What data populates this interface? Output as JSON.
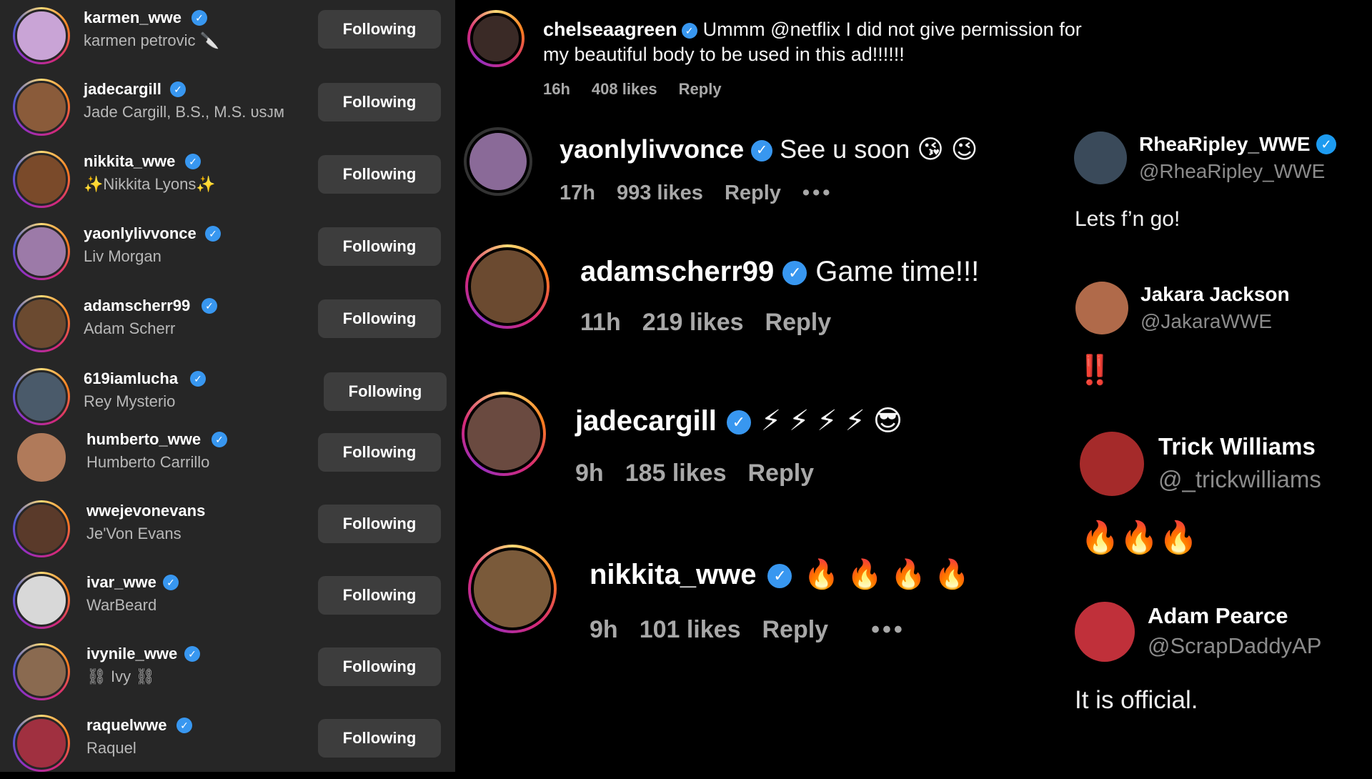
{
  "following": {
    "button_label": "Following",
    "items": [
      {
        "username": "karmen_wwe",
        "name": "karmen petrovic 🔪",
        "avatar_color": "#c9a4d6"
      },
      {
        "username": "jadecargill",
        "name": "Jade Cargill, B.S., M.S. ᴜsᴊᴍ",
        "avatar_color": "#8a5b3a"
      },
      {
        "username": "nikkita_wwe",
        "name": "✨Nikkita Lyons✨",
        "avatar_color": "#7a4a2a"
      },
      {
        "username": "yaonlylivvonce",
        "name": "Liv Morgan",
        "avatar_color": "#9c7aa8"
      },
      {
        "username": "adamscherr99",
        "name": "Adam Scherr",
        "avatar_color": "#6b4a30"
      },
      {
        "username": "619iamlucha",
        "name": "Rey Mysterio",
        "avatar_color": "#4a5a6a"
      },
      {
        "username": "humberto_wwe",
        "name": "Humberto Carrillo",
        "avatar_color": "#b07a5a"
      },
      {
        "username": "wwejevonevans",
        "name": "Je'Von Evans",
        "avatar_color": "#5a3a2a"
      },
      {
        "username": "ivar_wwe",
        "name": "WarBeard",
        "avatar_color": "#d8d8d8"
      },
      {
        "username": "ivynile_wwe",
        "name": "⛓ Ivy ⛓",
        "avatar_color": "#8a6a50"
      },
      {
        "username": "raquelwwe",
        "name": "Raquel",
        "avatar_color": "#a03040"
      }
    ]
  },
  "comments": [
    {
      "username": "chelseaagreen",
      "text": "Ummm @netflix I did not give permission for my beautiful body to be used in this ad!!!!!!",
      "time": "16h",
      "likes": "408 likes",
      "reply": "Reply",
      "avatar_color": "#3a2a26"
    },
    {
      "username": "yaonlylivvonce",
      "text": "See u soon 😘 😉",
      "time": "17h",
      "likes": "993 likes",
      "reply": "Reply",
      "more": "•••",
      "avatar_color": "#8a6a98"
    },
    {
      "username": "adamscherr99",
      "text": "Game time!!!",
      "time": "11h",
      "likes": "219 likes",
      "reply": "Reply",
      "avatar_color": "#6b4a30"
    },
    {
      "username": "jadecargill",
      "text": "⚡ ⚡ ⚡ ⚡ 😎",
      "time": "9h",
      "likes": "185 likes",
      "reply": "Reply",
      "avatar_color": "#6a4a40"
    },
    {
      "username": "nikkita_wwe",
      "text": "🔥 🔥 🔥 🔥",
      "time": "9h",
      "likes": "101 likes",
      "reply": "Reply",
      "more": "•••",
      "avatar_color": "#7a5a3a"
    }
  ],
  "tweets": [
    {
      "name": "RheaRipley_WWE",
      "handle": "@RheaRipley_WWE",
      "text": "Lets f’n go!",
      "verified": true,
      "avatar_color": "#3a4a5a"
    },
    {
      "name": "Jakara Jackson",
      "handle": "@JakaraWWE",
      "text": "‼️",
      "verified": false,
      "avatar_color": "#b06a4a"
    },
    {
      "name": "Trick Williams",
      "handle": "@_trickwilliams",
      "text": "🔥🔥🔥",
      "verified": false,
      "avatar_color": "#a52a2a"
    },
    {
      "name": "Adam Pearce",
      "handle": "@ScrapDaddyAP",
      "text": "It is official.",
      "verified": false,
      "avatar_color": "#c0303a"
    }
  ],
  "colors": {
    "verified_blue": "#3897f0",
    "panel_bg": "#262626",
    "button_bg": "#3d3d3d"
  }
}
